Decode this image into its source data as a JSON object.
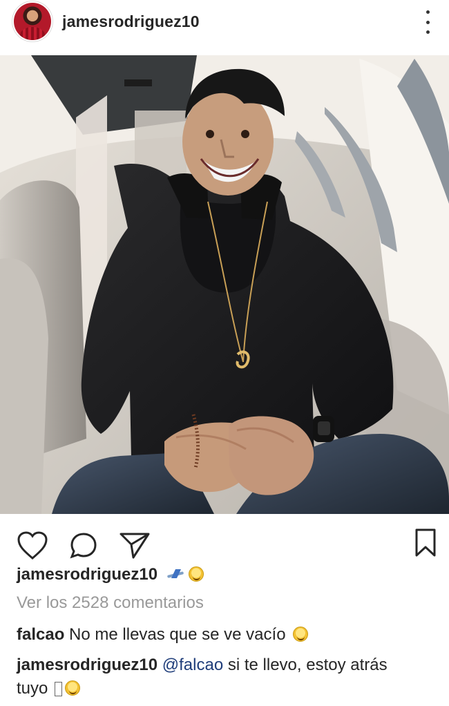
{
  "post": {
    "username": "jamesrodriguez10",
    "avatar_icon": "avatar-image",
    "more_icon": "more-vertical-icon"
  },
  "actions": {
    "like_icon": "heart-icon",
    "comment_icon": "comment-icon",
    "share_icon": "send-icon",
    "save_icon": "bookmark-icon"
  },
  "caption": {
    "username": "jamesrodriguez10",
    "emoji_icons": [
      "airplane-icon",
      "grinning-face-icon"
    ]
  },
  "comments_link": "Ver los 2528 comentarios",
  "comments": [
    {
      "username": "falcao",
      "text": "No me llevas que se ve vacío",
      "emoji_icon": "winking-face-icon"
    },
    {
      "username": "jamesrodriguez10",
      "mention": "@falcao",
      "text_1": " si te llevo, estoy atrás",
      "text_2": "tuyo ",
      "missing_glyph": "unsupported-emoji-box",
      "emoji_icon": "laughing-face-icon"
    }
  ]
}
